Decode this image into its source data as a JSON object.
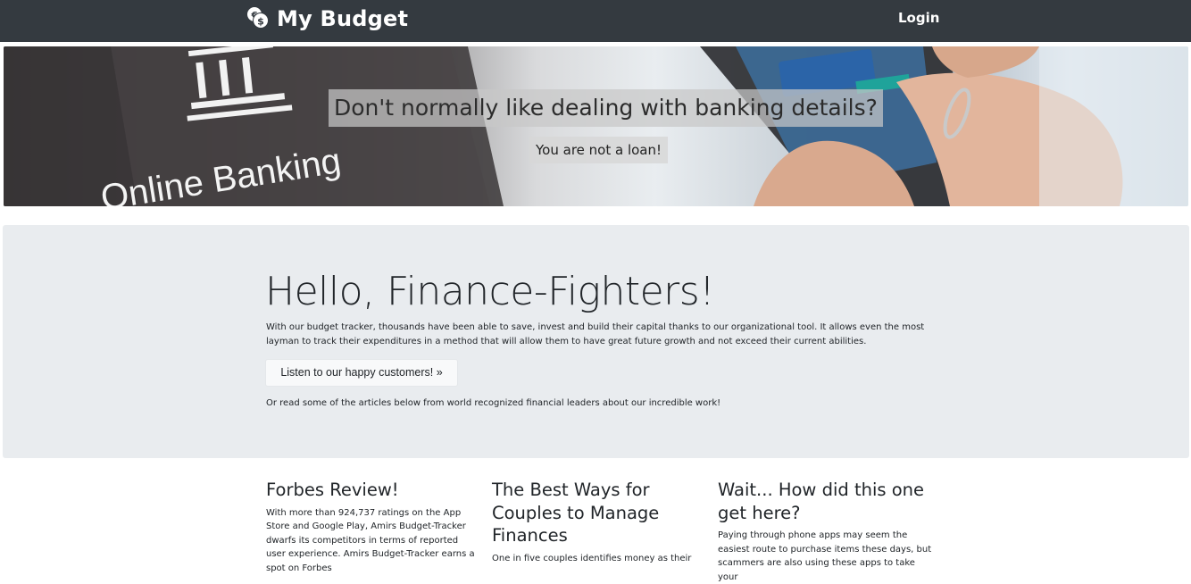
{
  "navbar": {
    "brand": "My Budget",
    "login": "Login"
  },
  "hero": {
    "headline": "Don't normally like dealing with banking details?",
    "subheadline": "You are not a loan!",
    "image_text": "Online Banking"
  },
  "jumbotron": {
    "title": "Hello, Finance-Fighters!",
    "text": "With our budget tracker, thousands have been able to save, invest and build their capital thanks to our organizational tool. It allows even the most layman to track their expenditures in a method that will allow them to have great future growth and not exceed their current abilities.",
    "button_label": "Listen to our happy customers! »",
    "note": "Or read some of the articles below from world recognized financial leaders about our incredible work!"
  },
  "articles": [
    {
      "title": "Forbes Review!",
      "body": "With more than 924,737 ratings on the App Store and Google Play, Amirs Budget-Tracker dwarfs its competitors in terms of reported user experience. Amirs Budget-Tracker earns a spot on Forbes"
    },
    {
      "title": "The Best Ways for Couples to Manage Finances",
      "body": "One in five couples identifies money as their"
    },
    {
      "title": "Wait... How did this one get here?",
      "body": "Paying through phone apps may seem the easiest route to purchase items these days, but scammers are also using these apps to take your"
    }
  ]
}
